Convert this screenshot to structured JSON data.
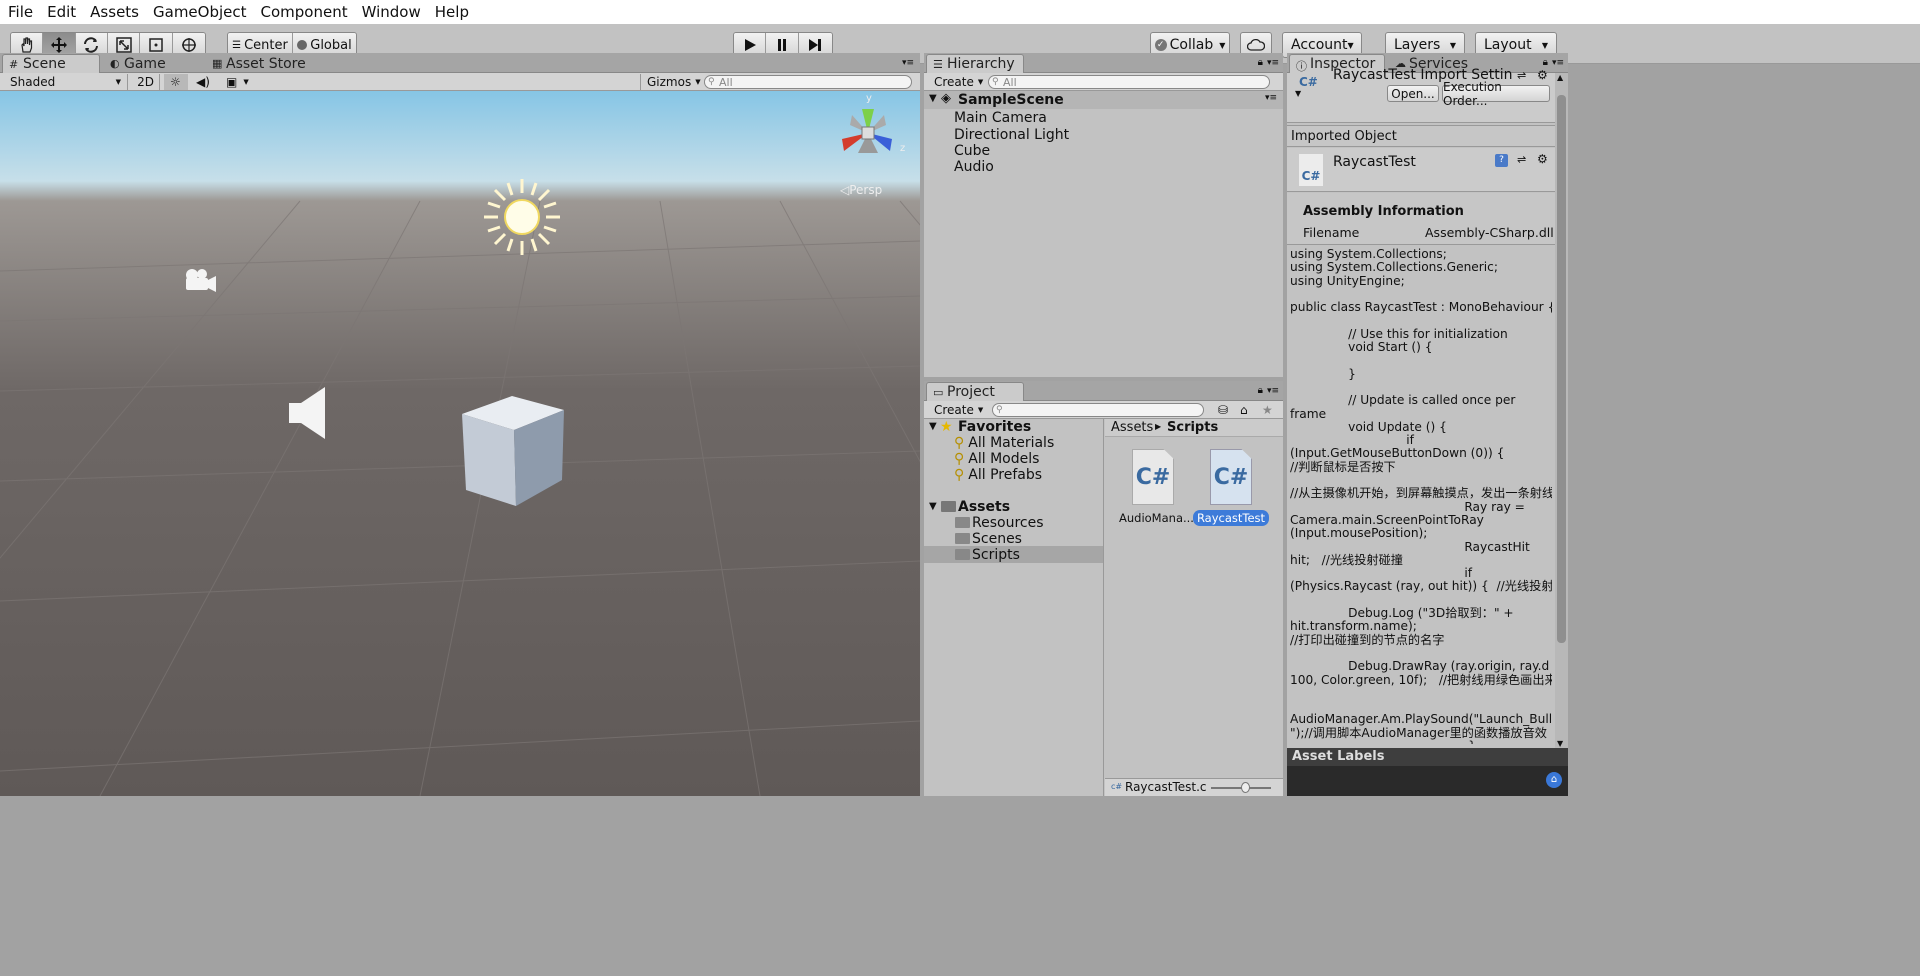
{
  "menu": [
    "File",
    "Edit",
    "Assets",
    "GameObject",
    "Component",
    "Window",
    "Help"
  ],
  "toolbar": {
    "pivot_center": "Center",
    "pivot_global": "Global",
    "collab": "Collab",
    "account": "Account",
    "layers": "Layers",
    "layout": "Layout"
  },
  "scene": {
    "tabs": [
      "Scene",
      "Game",
      "Asset Store"
    ],
    "shading": "Shaded",
    "mode_2d": "2D",
    "gizmos": "Gizmos",
    "search_placeholder": "All",
    "persp": "Persp",
    "axis_y": "y",
    "axis_z": "z"
  },
  "hierarchy": {
    "tab": "Hierarchy",
    "create": "Create",
    "search_placeholder": "All",
    "scene": "SampleScene",
    "items": [
      "Main Camera",
      "Directional Light",
      "Cube",
      "Audio"
    ]
  },
  "project": {
    "tab": "Project",
    "create": "Create",
    "favorites": "Favorites",
    "favorite_items": [
      "All Materials",
      "All Models",
      "All Prefabs"
    ],
    "assets": "Assets",
    "folders": [
      "Resources",
      "Scenes",
      "Scripts"
    ],
    "breadcrumb_root": "Assets",
    "breadcrumb_current": "Scripts",
    "files": [
      {
        "name": "AudioMana...",
        "icon": "C#"
      },
      {
        "name": "RaycastTest",
        "icon": "C#"
      }
    ],
    "footer_file": "RaycastTest.cs"
  },
  "inspector": {
    "tabs": [
      "Inspector",
      "Services"
    ],
    "title": "RaycastTest Import Setting",
    "open": "Open...",
    "execution_order": "Execution Order...",
    "imported_object": "Imported Object",
    "script_name": "RaycastTest",
    "cs": "C#",
    "assembly_heading": "Assembly Information",
    "filename_label": "Filename",
    "filename_value": "Assembly-CSharp.dll",
    "asset_labels": "Asset Labels",
    "code": "using System.Collections;\nusing System.Collections.Generic;\nusing UnityEngine;\n\npublic class RaycastTest : MonoBehaviour {\n\n               // Use this for initialization\n               void Start () {\n\n               }\n\n               // Update is called once per\nframe\n               void Update () {\n                              if\n(Input.GetMouseButtonDown (0)) {\n//判断鼠标是否按下\n\n//从主摄像机开始，到屏幕触摸点，发出一条射线\n                                             Ray ray =\nCamera.main.ScreenPointToRay\n(Input.mousePosition);\n                                             RaycastHit\nhit;   //光线投射碰撞\n                                             if\n(Physics.Raycast (ray, out hit)) {  //光线投射\n\n               Debug.Log (\"3D拾取到：\" +\nhit.transform.name);\n//打印出碰撞到的节点的名字\n\n               Debug.DrawRay (ray.origin, ray.d\n100, Color.green, 10f);   //把射线用绿色画出来\n\n\nAudioManager.Am.PlaySound(\"Launch_Bullet\n\");//调用脚本AudioManager里的函数播放音效\n                                              }"
  }
}
